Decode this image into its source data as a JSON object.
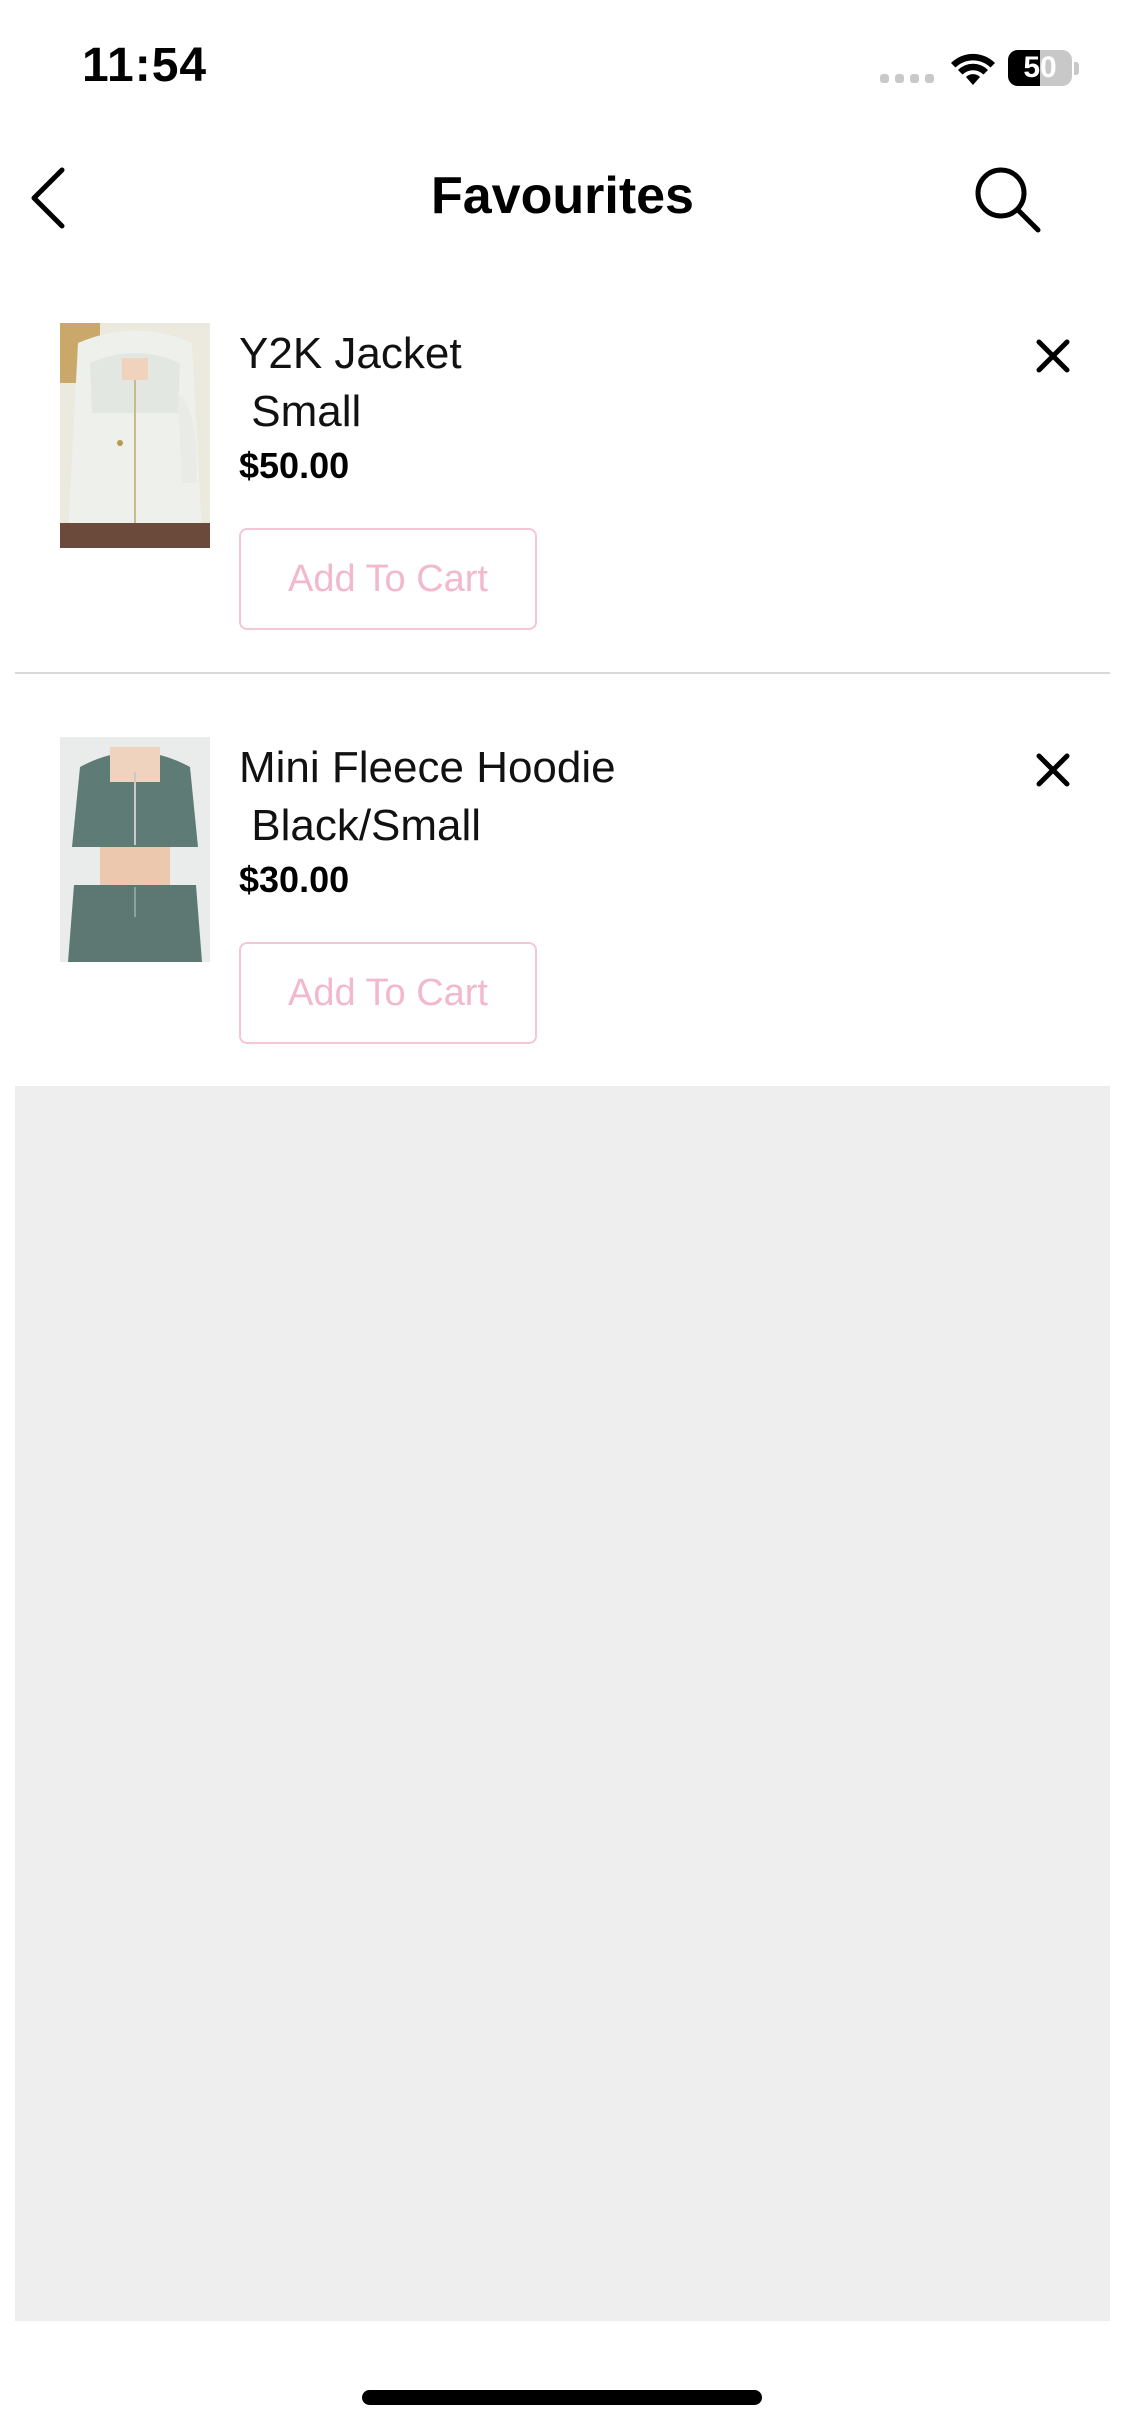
{
  "status_bar": {
    "time": "11:54",
    "battery_level": "50"
  },
  "nav": {
    "title": "Favourites",
    "back_icon": "chevron-left-icon",
    "search_icon": "search-icon"
  },
  "items": [
    {
      "name": "Y2K Jacket",
      "variant": " Small",
      "price": "$50.00",
      "add_label": "Add To Cart",
      "image": "cream-zip-jacket-photo"
    },
    {
      "name": "Mini Fleece Hoodie",
      "variant": " Black/Small",
      "price": "$30.00",
      "add_label": "Add To Cart",
      "image": "green-cropped-hoodie-set-photo"
    }
  ],
  "colors": {
    "accent_pink": "#f2b8cd",
    "empty_bg": "#eeeeee",
    "divider": "#d9d9d9"
  }
}
